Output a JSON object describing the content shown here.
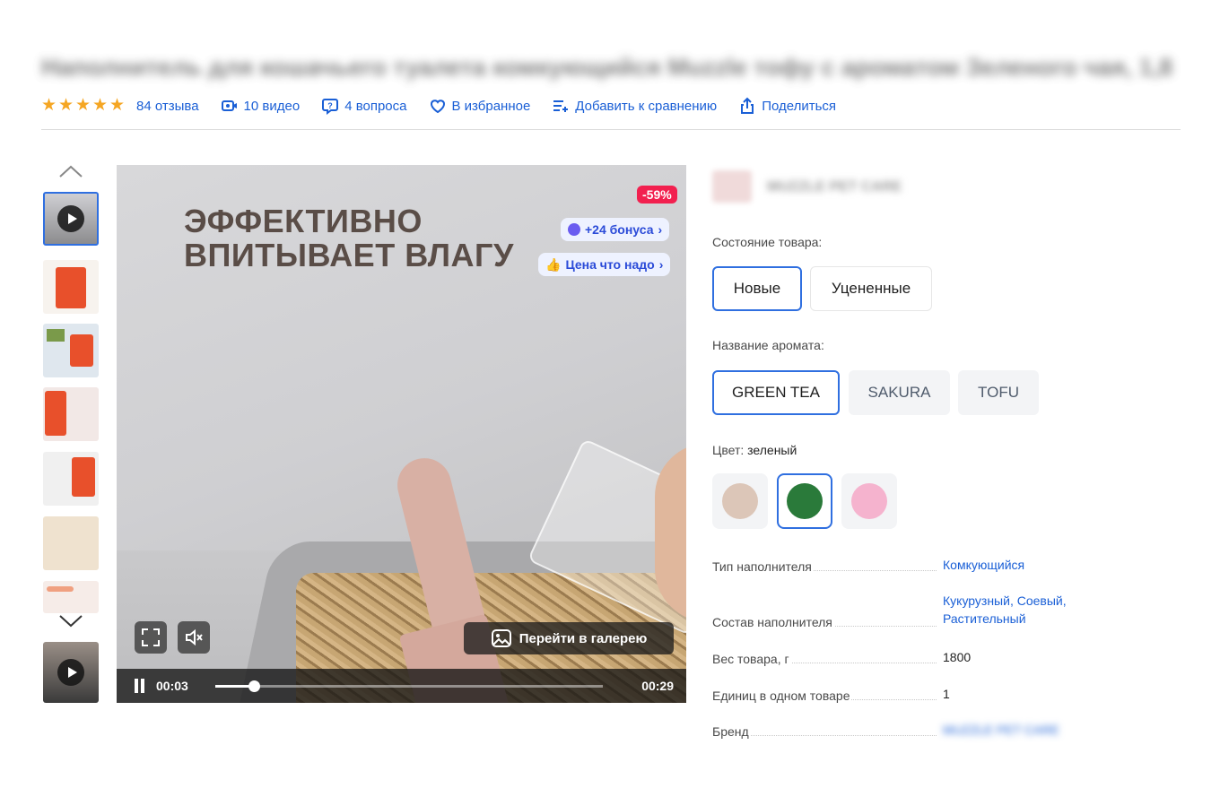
{
  "product": {
    "title": "Наполнитель для кошачьего туалета комкующийся Muzzle тофу с ароматом Зеленого чая, 1,8",
    "rating": {
      "value": 4.5,
      "reviews_label": "84 отзыва"
    },
    "meta": {
      "videos_label": "10 видео",
      "questions_label": "4 вопроса",
      "favorite_label": "В избранное",
      "compare_label": "Добавить к сравнению",
      "share_label": "Поделиться"
    }
  },
  "media": {
    "headline_line1": "ЭФФЕКТИВНО",
    "headline_line2": "ВПИТЫВАЕТ ВЛАГУ",
    "discount_badge": "-59%",
    "bonus_pill": "+24 бонуса",
    "price_pill": "Цена что надо",
    "gallery_button": "Перейти в галерею",
    "time_current": "00:03",
    "time_total": "00:29",
    "progress_fraction": 0.1
  },
  "brand": {
    "name": "MUZZLE PET CARE"
  },
  "options": {
    "condition_label": "Состояние товара:",
    "condition": [
      "Новые",
      "Уцененные"
    ],
    "aroma_label": "Название аромата:",
    "aroma": [
      "GREEN TEA",
      "SAKURA",
      "TOFU"
    ],
    "color_label": "Цвет:",
    "color_value": "зеленый",
    "colors": [
      "#dcc6b8",
      "#2a7a3a",
      "#f5b3ce"
    ]
  },
  "specs": [
    {
      "name": "Тип наполнителя",
      "value": "Комкующийся"
    },
    {
      "name": "Состав наполнителя",
      "value_line1": "Кукурузный, Соевый,",
      "value_line2": "Растительный"
    },
    {
      "name": "Вес товара, г",
      "value": "1800"
    },
    {
      "name": "Единиц в одном товаре",
      "value": "1"
    },
    {
      "name": "Бренд",
      "value": "MUZZLE PET CARE"
    }
  ],
  "colors": {
    "accent": "#2f6fe0",
    "link": "#1a5fd6",
    "star": "#f5a623",
    "sale": "#f2204f"
  }
}
